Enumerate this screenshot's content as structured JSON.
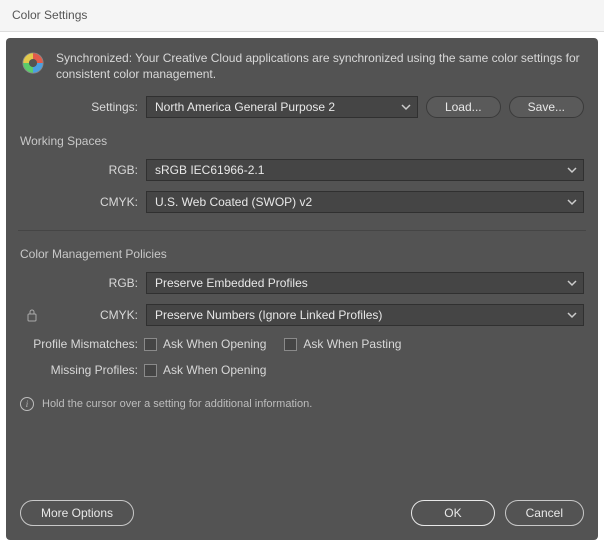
{
  "window": {
    "title": "Color Settings"
  },
  "sync": {
    "text": "Synchronized: Your Creative Cloud applications are synchronized using the same color settings for consistent color management."
  },
  "settings": {
    "label": "Settings:",
    "value": "North America General Purpose 2",
    "load": "Load...",
    "save": "Save..."
  },
  "workingSpaces": {
    "title": "Working Spaces",
    "rgbLabel": "RGB:",
    "rgbValue": "sRGB IEC61966-2.1",
    "cmykLabel": "CMYK:",
    "cmykValue": "U.S. Web Coated (SWOP) v2"
  },
  "policies": {
    "title": "Color Management Policies",
    "rgbLabel": "RGB:",
    "rgbValue": "Preserve Embedded Profiles",
    "cmykLabel": "CMYK:",
    "cmykValue": "Preserve Numbers (Ignore Linked Profiles)",
    "mismatchLabel": "Profile Mismatches:",
    "missingLabel": "Missing Profiles:",
    "askOpen": "Ask When Opening",
    "askPaste": "Ask When Pasting"
  },
  "info": {
    "text": "Hold the cursor over a setting for additional information."
  },
  "footer": {
    "more": "More Options",
    "ok": "OK",
    "cancel": "Cancel"
  }
}
